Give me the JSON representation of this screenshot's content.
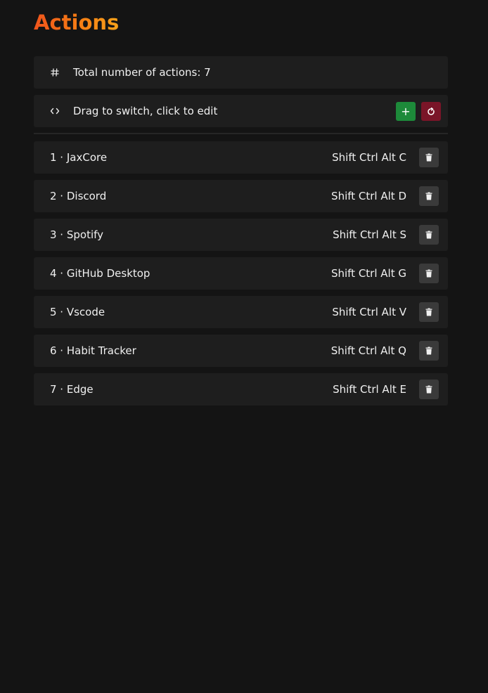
{
  "page": {
    "title": "Actions"
  },
  "summary": {
    "icon": "hash-icon",
    "text": "Total number of actions: 7"
  },
  "controls": {
    "icon": "code-brackets-icon",
    "text": "Drag to switch, click to edit",
    "add_label": "+",
    "add_color": "#1d8a3a",
    "reset_icon": "reset-icon",
    "reset_color": "#7a1528"
  },
  "actions": [
    {
      "name": "1 · JaxCore",
      "shortcut": "Shift Ctrl Alt C"
    },
    {
      "name": "2 · Discord",
      "shortcut": "Shift Ctrl Alt D"
    },
    {
      "name": "3 · Spotify",
      "shortcut": "Shift Ctrl Alt S"
    },
    {
      "name": "4 · GitHub Desktop",
      "shortcut": "Shift Ctrl Alt G"
    },
    {
      "name": "5 · Vscode",
      "shortcut": "Shift Ctrl Alt V"
    },
    {
      "name": "6 · Habit Tracker",
      "shortcut": "Shift Ctrl Alt Q"
    },
    {
      "name": "7 · Edge",
      "shortcut": "Shift Ctrl Alt E"
    }
  ],
  "colors": {
    "background": "#141414",
    "panel": "#1e1e1e",
    "accent_start": "#f0541c",
    "accent_end": "#f7a21a"
  }
}
